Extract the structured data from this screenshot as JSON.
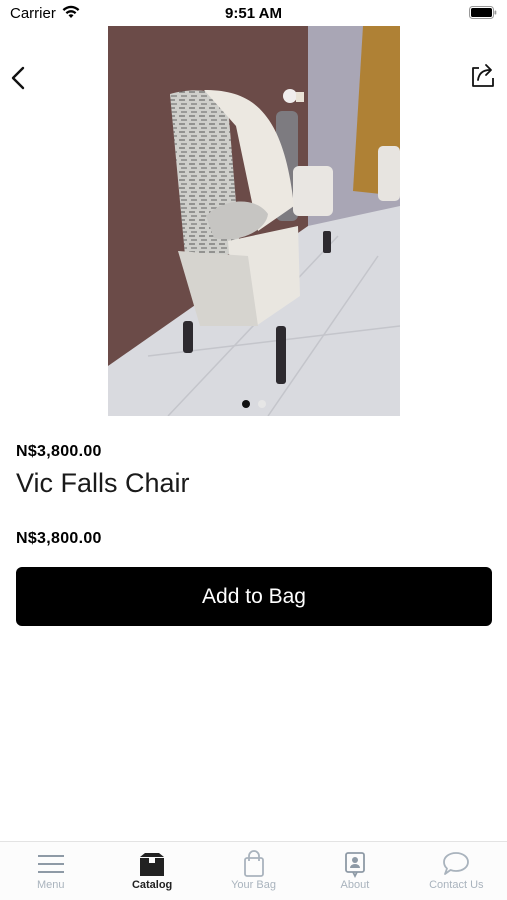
{
  "status_bar": {
    "carrier": "Carrier",
    "time": "9:51 AM"
  },
  "product": {
    "price_header": "N$3,800.00",
    "title": "Vic Falls Chair",
    "price": "N$3,800.00",
    "add_button_label": "Add to Bag",
    "image_count": 2,
    "active_image_index": 0
  },
  "tab_bar": {
    "items": [
      {
        "label": "Menu",
        "icon": "hamburger-menu-icon",
        "active": false
      },
      {
        "label": "Catalog",
        "icon": "box-icon",
        "active": true
      },
      {
        "label": "Your Bag",
        "icon": "shopping-bag-icon",
        "active": false
      },
      {
        "label": "About",
        "icon": "contact-card-icon",
        "active": false
      },
      {
        "label": "Contact Us",
        "icon": "chat-bubble-icon",
        "active": false
      }
    ]
  },
  "colors": {
    "primary_button": "#000000",
    "tab_inactive": "#a9b3bd",
    "tab_active": "#222222"
  }
}
